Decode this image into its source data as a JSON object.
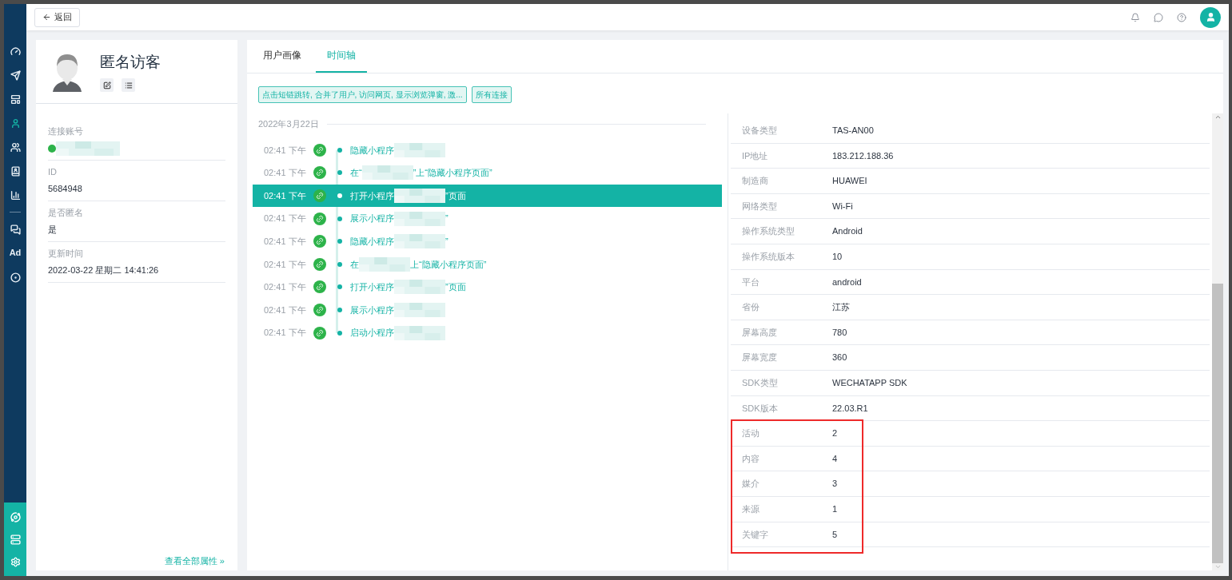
{
  "top_bar": {
    "back_button": "返回"
  },
  "sidebar": {
    "items": [
      {
        "kind": "gauge",
        "selected": false
      },
      {
        "kind": "send",
        "selected": false
      },
      {
        "kind": "layout",
        "selected": false
      },
      {
        "kind": "user",
        "selected": true
      },
      {
        "kind": "users",
        "selected": false
      },
      {
        "kind": "badge",
        "selected": false
      },
      {
        "kind": "chart",
        "selected": false
      },
      {
        "kind": "wechat",
        "selected": false
      },
      {
        "kind": "ad",
        "label": "Ad",
        "selected": false
      },
      {
        "kind": "target",
        "selected": false
      }
    ],
    "bottom_items": [
      {
        "kind": "orbit"
      },
      {
        "kind": "server"
      },
      {
        "kind": "settings"
      }
    ]
  },
  "profile": {
    "name": "匿名访客",
    "fields": [
      {
        "label": "连接账号",
        "kind": "redacted"
      },
      {
        "label": "ID",
        "value": "5684948"
      },
      {
        "label": "是否匿名",
        "value": "是"
      },
      {
        "label": "更新时间",
        "value": "2022-03-22 星期二 14:41:26"
      }
    ],
    "view_all_link": "查看全部属性 »"
  },
  "tabs": [
    {
      "label": "用户画像",
      "selected": false
    },
    {
      "label": "时间轴",
      "selected": true
    }
  ],
  "filters": [
    "点击短链跳转, 合并了用户, 访问网页, 显示浏览弹窗, 激...",
    "所有连接"
  ],
  "timeline": {
    "date": "2022年3月22日",
    "events": [
      {
        "time": "02:41 下午",
        "prefix": "隐藏小程序",
        "selected": false
      },
      {
        "time": "02:41 下午",
        "prefix": "在“",
        "suffix": "”上“隐藏小程序页面”",
        "selected": false
      },
      {
        "time": "02:41 下午",
        "prefix": "打开小程序",
        "suffix": "”页面",
        "selected": true
      },
      {
        "time": "02:41 下午",
        "prefix": "展示小程序",
        "suffix": "”",
        "selected": false
      },
      {
        "time": "02:41 下午",
        "prefix": "隐藏小程序",
        "suffix": "”",
        "selected": false
      },
      {
        "time": "02:41 下午",
        "prefix": "在",
        "suffix": "上“隐藏小程序页面”",
        "selected": false
      },
      {
        "time": "02:41 下午",
        "prefix": "打开小程序",
        "suffix": "”页面",
        "selected": false
      },
      {
        "time": "02:41 下午",
        "prefix": "展示小程序",
        "selected": false
      },
      {
        "time": "02:41 下午",
        "prefix": "启动小程序",
        "selected": false
      }
    ]
  },
  "properties": {
    "rows": [
      {
        "label": "设备类型",
        "value": "TAS-AN00"
      },
      {
        "label": "IP地址",
        "value": "183.212.188.36"
      },
      {
        "label": "制造商",
        "value": "HUAWEI"
      },
      {
        "label": "网络类型",
        "value": "Wi-Fi"
      },
      {
        "label": "操作系统类型",
        "value": "Android"
      },
      {
        "label": "操作系统版本",
        "value": "10"
      },
      {
        "label": "平台",
        "value": "android"
      },
      {
        "label": "省份",
        "value": "江苏"
      },
      {
        "label": "屏幕高度",
        "value": "780"
      },
      {
        "label": "屏幕宽度",
        "value": "360"
      },
      {
        "label": "SDK类型",
        "value": "WECHATAPP SDK"
      },
      {
        "label": "SDK版本",
        "value": "22.03.R1"
      }
    ],
    "highlighted_rows": [
      {
        "label": "活动",
        "value": "2"
      },
      {
        "label": "内容",
        "value": "4"
      },
      {
        "label": "媒介",
        "value": "3"
      },
      {
        "label": "来源",
        "value": "1"
      },
      {
        "label": "关键字",
        "value": "5"
      }
    ]
  }
}
